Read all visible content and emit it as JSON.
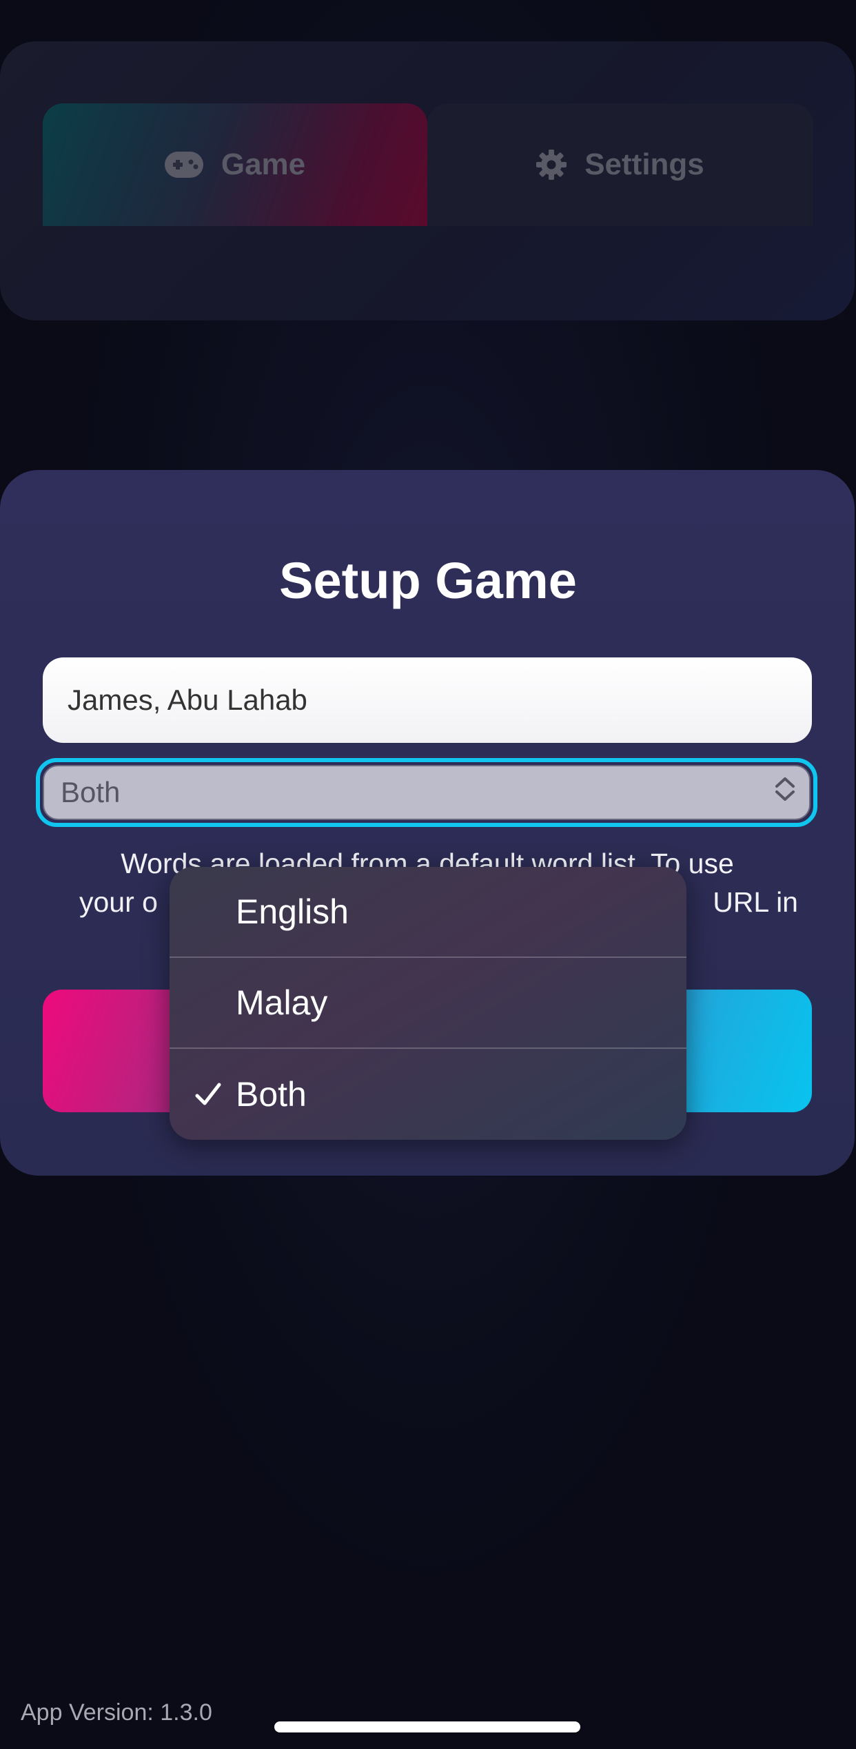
{
  "nav": {
    "tabs": [
      {
        "label": "Game",
        "icon": "gamepad-icon",
        "active": true
      },
      {
        "label": "Settings",
        "icon": "gear-icon",
        "active": false
      }
    ]
  },
  "setup": {
    "title": "Setup Game",
    "players_value": "James, Abu Lahab",
    "language_selected": "Both",
    "info_line1": "Words are loaded from a default word list. To use",
    "info_line2_left": "your o",
    "info_line2_right": "URL in"
  },
  "dropdown": {
    "options": [
      {
        "label": "English",
        "selected": false
      },
      {
        "label": "Malay",
        "selected": false
      },
      {
        "label": "Both",
        "selected": true
      }
    ],
    "check_glyph": "✓"
  },
  "footer": {
    "app_version": "App Version: 1.3.0"
  },
  "colors": {
    "accent_cyan": "#10c5ee",
    "accent_pink": "#ee0a7d",
    "card_bg": "#2c2c55",
    "page_bg": "#0a0b17"
  }
}
